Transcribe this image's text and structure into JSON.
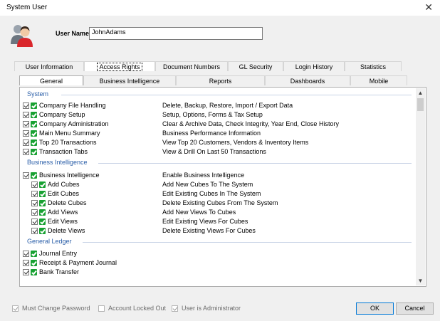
{
  "window": {
    "title": "System User",
    "close_symbol": "✕"
  },
  "user": {
    "label": "User Name:",
    "value": "JohnAdams"
  },
  "main_tabs": [
    "User Information",
    "Access Rights",
    "Document Numbers",
    "GL Security",
    "Login History",
    "Statistics"
  ],
  "sub_tabs": [
    "General",
    "Business Intelligence",
    "Reports",
    "Dashboards",
    "Mobile"
  ],
  "sections": {
    "system": {
      "title": "System",
      "items": [
        {
          "label": "Company File Handling",
          "desc": "Delete, Backup, Restore, Import / Export Data"
        },
        {
          "label": "Company Setup",
          "desc": "Setup, Options, Forms & Tax Setup"
        },
        {
          "label": "Company Administration",
          "desc": "Clear & Archive Data, Check Integrity, Year End, Close History"
        },
        {
          "label": "Main Menu Summary",
          "desc": "Business Performance Information"
        },
        {
          "label": "Top 20 Transactions",
          "desc": "View Top 20 Customers, Vendors & Inventory Items"
        },
        {
          "label": "Transaction Tabs",
          "desc": "View & Drill On Last 50 Transactions"
        }
      ]
    },
    "bi": {
      "title": "Business Intelligence",
      "items": [
        {
          "label": "Business Intelligence",
          "desc": "Enable Business Intelligence"
        },
        {
          "label": "Add Cubes",
          "desc": "Add New Cubes To The System"
        },
        {
          "label": "Edit Cubes",
          "desc": "Edit Existing Cubes In The System"
        },
        {
          "label": "Delete Cubes",
          "desc": "Delete Existing Cubes From The System"
        },
        {
          "label": "Add Views",
          "desc": "Add New Views To Cubes"
        },
        {
          "label": "Edit Views",
          "desc": "Edit Existing Views For Cubes"
        },
        {
          "label": "Delete Views",
          "desc": "Delete Existing Views For Cubes"
        }
      ]
    },
    "gl": {
      "title": "General Ledger",
      "items": [
        {
          "label": "Journal Entry",
          "desc": ""
        },
        {
          "label": "Receipt & Payment Journal",
          "desc": ""
        },
        {
          "label": "Bank Transfer",
          "desc": ""
        }
      ]
    }
  },
  "options": [
    {
      "label": "Must Change Password",
      "checked": true
    },
    {
      "label": "Account Locked Out",
      "checked": false
    },
    {
      "label": "User is Administrator",
      "checked": true
    }
  ],
  "buttons": {
    "ok": "OK",
    "cancel": "Cancel"
  },
  "icons": {
    "user": "users-icon",
    "scroll_up": "▲",
    "scroll_down": "▼"
  }
}
